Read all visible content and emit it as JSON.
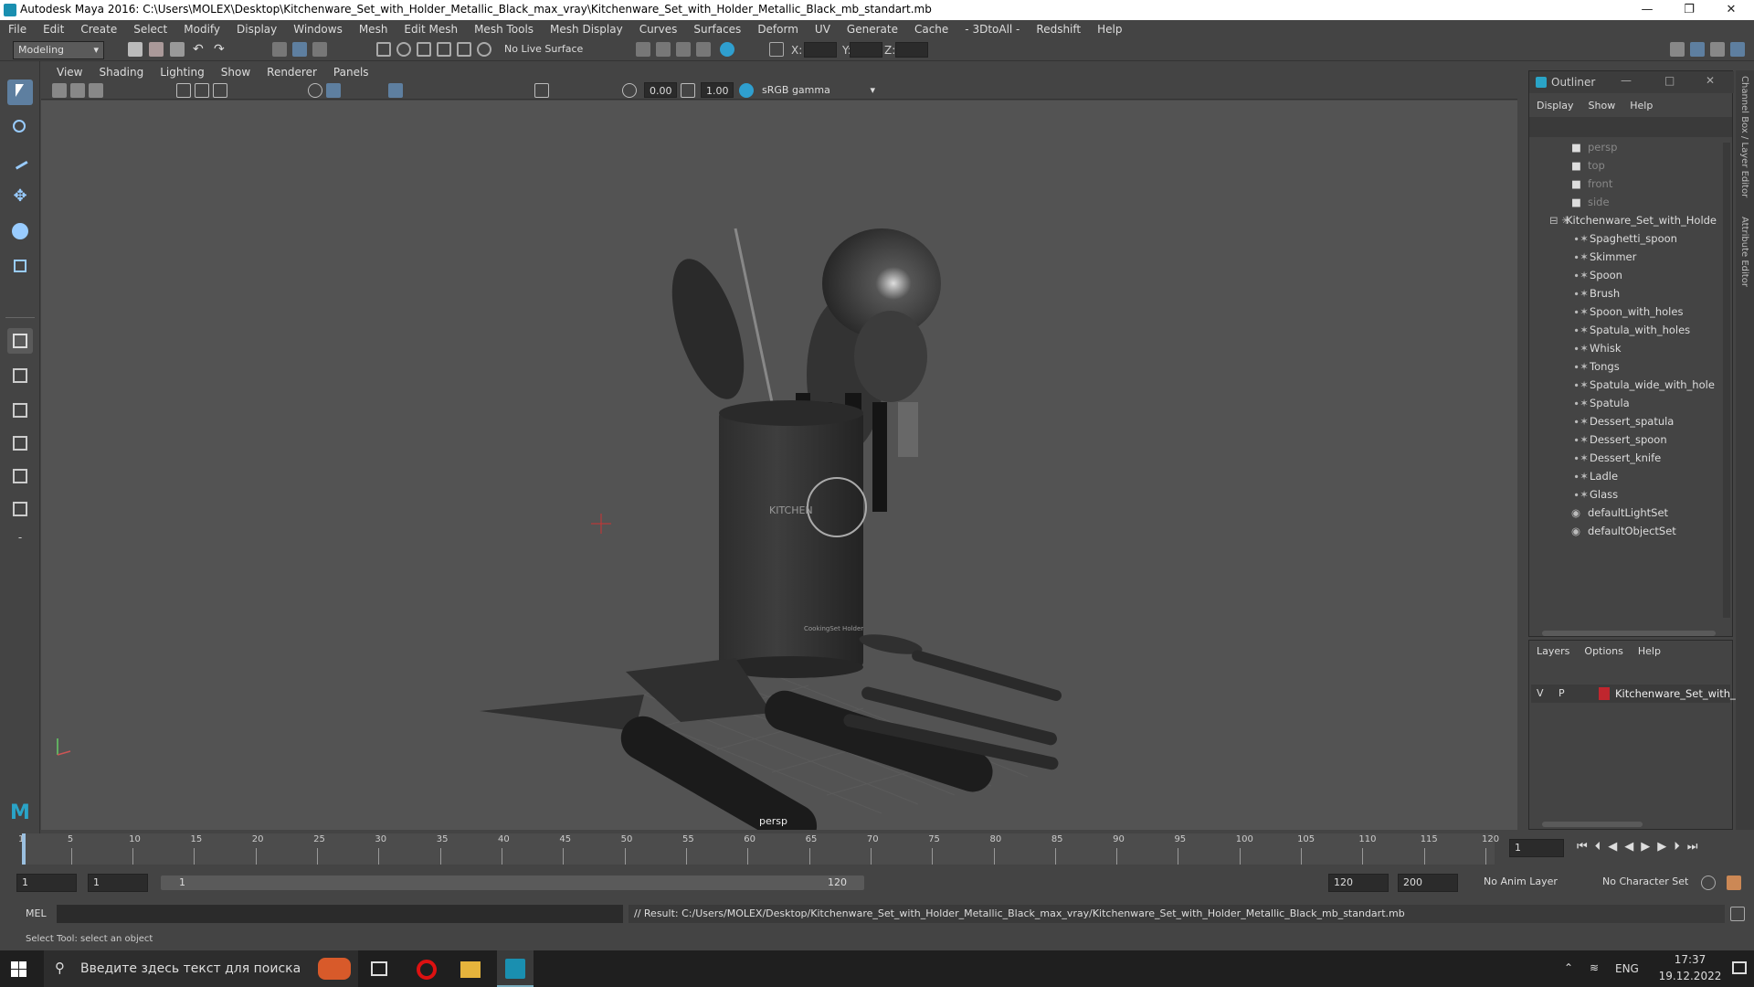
{
  "window": {
    "title": "Autodesk Maya 2016: C:\\Users\\MOLEX\\Desktop\\Kitchenware_Set_with_Holder_Metallic_Black_max_vray\\Kitchenware_Set_with_Holder_Metallic_Black_mb_standart.mb"
  },
  "menubar": [
    "File",
    "Edit",
    "Create",
    "Select",
    "Modify",
    "Display",
    "Windows",
    "Mesh",
    "Edit Mesh",
    "Mesh Tools",
    "Mesh Display",
    "Curves",
    "Surfaces",
    "Deform",
    "UV",
    "Generate",
    "Cache",
    "- 3DtoAll -",
    "Redshift",
    "Help"
  ],
  "shelf": {
    "mode": "Modeling",
    "live_surface": "No Live Surface",
    "x_label": "X:",
    "y_label": "Y:",
    "z_label": "Z:"
  },
  "panel": {
    "menus": [
      "View",
      "Shading",
      "Lighting",
      "Show",
      "Renderer",
      "Panels"
    ],
    "exposure": "0.00",
    "gamma": "1.00",
    "color_space": "sRGB gamma",
    "camera_label": "persp"
  },
  "outliner": {
    "title": "Outliner",
    "menus": [
      "Display",
      "Show",
      "Help"
    ],
    "cameras": [
      "persp",
      "top",
      "front",
      "side"
    ],
    "group": "Kitchenware_Set_with_Holde",
    "children": [
      "Spaghetti_spoon",
      "Skimmer",
      "Spoon",
      "Brush",
      "Spoon_with_holes",
      "Spatula_with_holes",
      "Whisk",
      "Tongs",
      "Spatula_wide_with_hole",
      "Spatula",
      "Dessert_spatula",
      "Dessert_spoon",
      "Dessert_knife",
      "Ladle",
      "Glass"
    ],
    "sets": [
      "defaultLightSet",
      "defaultObjectSet"
    ]
  },
  "layers": {
    "menus": [
      "Layers",
      "Options",
      "Help"
    ],
    "v": "V",
    "p": "P",
    "layer_name": "Kitchenware_Set_with_H",
    "layer_color": "#c0262e"
  },
  "side_tabs": {
    "channel": "Channel Box / Layer Editor",
    "attr": "Attribute Editor"
  },
  "timeline": {
    "ticks": [
      "1",
      "5",
      "10",
      "15",
      "20",
      "25",
      "30",
      "35",
      "40",
      "45",
      "50",
      "55",
      "60",
      "65",
      "70",
      "75",
      "80",
      "85",
      "90",
      "95",
      "100",
      "105",
      "110",
      "115",
      "120"
    ],
    "current_frame": "1"
  },
  "range": {
    "start": "1",
    "inner_start": "1",
    "slider_start": "1",
    "slider_end": "120",
    "end": "120",
    "max_end": "200",
    "anim_layer": "No Anim Layer",
    "char_set": "No Character Set"
  },
  "cmd": {
    "lang": "MEL",
    "result": "// Result: C:/Users/MOLEX/Desktop/Kitchenware_Set_with_Holder_Metallic_Black_max_vray/Kitchenware_Set_with_Holder_Metallic_Black_mb_standart.mb"
  },
  "help_line": "Select Tool: select an object",
  "taskbar": {
    "search_placeholder": "Введите здесь текст для поиска",
    "lang": "ENG",
    "time": "17:37",
    "date": "19.12.2022"
  },
  "mug_text": {
    "word": "KITCHEN",
    "brand": "CookingSet Holder"
  }
}
